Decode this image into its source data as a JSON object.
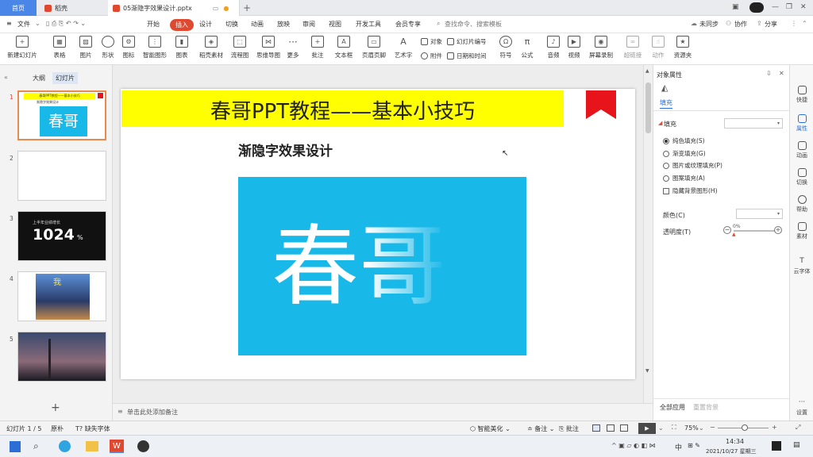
{
  "tabs": {
    "home": "首页",
    "docer": "稻壳",
    "document": "05渐隐字效果设计.pptx",
    "add": "+"
  },
  "window": {
    "minimize": "—",
    "restore": "❐",
    "close": "✕"
  },
  "menu": {
    "file": "文件",
    "items": [
      "开始",
      "插入",
      "设计",
      "切换",
      "动画",
      "放映",
      "审阅",
      "视图",
      "开发工具",
      "会员专享"
    ],
    "search": "查找命令、搜索模板",
    "unsync": "未同步",
    "collab": "协作",
    "share": "分享"
  },
  "ribbon": {
    "big": [
      {
        "label": "新建幻灯片",
        "icon": "new-slide-icon"
      },
      {
        "label": "表格",
        "icon": "table-icon"
      },
      {
        "label": "图片",
        "icon": "picture-icon"
      },
      {
        "label": "形状",
        "icon": "shape-icon"
      },
      {
        "label": "图标",
        "icon": "icons-icon"
      },
      {
        "label": "智能图形",
        "icon": "smartart-icon"
      },
      {
        "label": "图表",
        "icon": "chart-icon"
      },
      {
        "label": "稻壳素材",
        "icon": "docer-material-icon"
      },
      {
        "label": "流程图",
        "icon": "flowchart-icon"
      },
      {
        "label": "思维导图",
        "icon": "mindmap-icon"
      },
      {
        "label": "更多",
        "icon": "more-icon"
      },
      {
        "label": "批注",
        "icon": "comment-icon"
      },
      {
        "label": "文本框",
        "icon": "textbox-icon"
      },
      {
        "label": "页眉页脚",
        "icon": "header-footer-icon"
      },
      {
        "label": "艺术字",
        "icon": "wordart-icon"
      }
    ],
    "small": [
      "对象",
      "附件",
      "幻灯片编号",
      "日期和时间"
    ],
    "big2": [
      {
        "label": "符号",
        "icon": "symbol-icon"
      },
      {
        "label": "公式",
        "icon": "formula-icon"
      },
      {
        "label": "音频",
        "icon": "audio-icon"
      },
      {
        "label": "视频",
        "icon": "video-icon"
      },
      {
        "label": "屏幕录制",
        "icon": "screen-record-icon"
      },
      {
        "label": "超链接",
        "icon": "hyperlink-icon"
      },
      {
        "label": "动作",
        "icon": "action-icon"
      },
      {
        "label": "资源夹",
        "icon": "resource-folder-icon"
      }
    ]
  },
  "leftpane": {
    "tab_outline": "大纲",
    "tab_slides": "幻灯片",
    "add": "+"
  },
  "thumbs": {
    "t1_title": "春哥PPT教程——基本小技巧",
    "t1_sub": "渐隐字效果设计",
    "t1_char": "春哥",
    "t3_sub": "上半年业绩增长",
    "t3_big": "1024",
    "t3_unit": "%",
    "t4_char": "我"
  },
  "slide": {
    "banner_title": "春哥PPT教程——基本小技巧",
    "subtitle": "渐隐字效果设计",
    "big_text": "春哥",
    "banner_color": "#ffff00",
    "image_color": "#18b8e8",
    "bookmark_color": "#e8141c"
  },
  "notes": {
    "placeholder": "单击此处添加备注"
  },
  "rightpane": {
    "title": "对象属性",
    "tab": "填充",
    "section": "填充",
    "options": [
      "纯色填充(S)",
      "渐变填充(G)",
      "图片或纹理填充(P)",
      "图案填充(A)"
    ],
    "checkbox": "隐藏背景图形(H)",
    "color_label": "颜色(C)",
    "transparency_label": "透明度(T)",
    "transparency_value": "0%",
    "apply_all": "全部应用",
    "reset_bg": "重置背景"
  },
  "sidebar": [
    "快捷",
    "属性",
    "动画",
    "切换",
    "帮助",
    "素材",
    "云字体",
    "设置"
  ],
  "status": {
    "slide_info": "幻灯片 1 / 5",
    "theme": "原朴",
    "missing_font": "缺失字体",
    "beautify": "智能美化",
    "notes": "备注",
    "comments": "批注",
    "zoom": "75%"
  },
  "taskbar": {
    "time": "14:34",
    "date": "2021/10/27 星期三",
    "ime": "中"
  },
  "colors": {
    "accent": "#e0492f",
    "tab_blue": "#4a86e8"
  }
}
